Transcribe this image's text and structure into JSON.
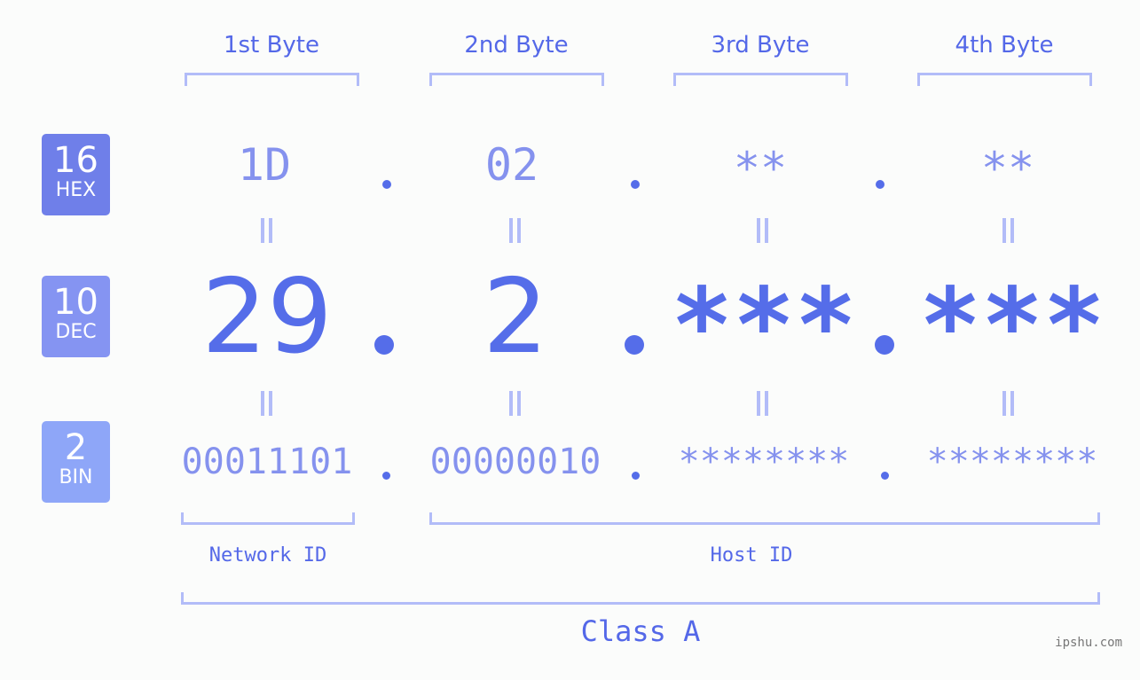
{
  "colors": {
    "background": "#fbfcfb",
    "accent": "#556de9",
    "accent_light": "#8592ee",
    "bracket": "#b2bcf8",
    "badge_hex": "#6f7fe9",
    "badge_dec": "#8594f2",
    "badge_bin": "#8ea6f8",
    "watermark": "#777777"
  },
  "bases": [
    {
      "number": "16",
      "label": "HEX"
    },
    {
      "number": "10",
      "label": "DEC"
    },
    {
      "number": "2",
      "label": "BIN"
    }
  ],
  "byte_headers": [
    "1st Byte",
    "2nd Byte",
    "3rd Byte",
    "4th Byte"
  ],
  "hex": [
    "1D",
    "02",
    "**",
    "**"
  ],
  "dec": [
    "29",
    "2",
    "***",
    "***"
  ],
  "bin": [
    "00011101",
    "00000010",
    "********",
    "********"
  ],
  "separator": ".",
  "equals_symbol": "=",
  "parts": {
    "network": "Network ID",
    "host": "Host ID"
  },
  "ip_class": "Class A",
  "watermark": "ipshu.com"
}
